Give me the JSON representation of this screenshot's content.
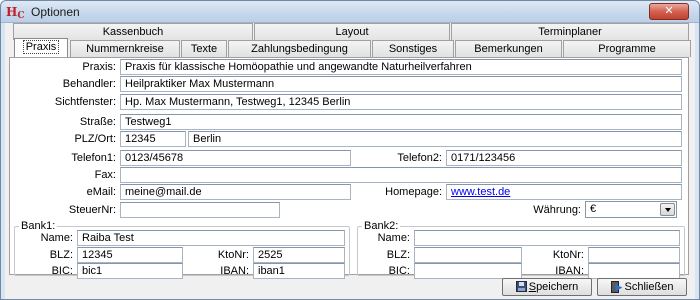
{
  "window": {
    "title": "Optionen",
    "icon_text": "H",
    "icon_sub": "C",
    "close_label": "✕"
  },
  "tabs_top": [
    "Kassenbuch",
    "Layout",
    "Terminplaner"
  ],
  "tabs_sub": [
    "Praxis",
    "Nummernkreise",
    "Texte",
    "Zahlungsbedingung",
    "Sonstiges",
    "Bemerkungen",
    "Programme"
  ],
  "active_tab": "Praxis",
  "form": {
    "praxis_label": "Praxis:",
    "praxis_value": "Praxis für klassische Homöopathie und angewandte Naturheilverfahren",
    "behandler_label": "Behandler:",
    "behandler_value": "Heilpraktiker Max Mustermann",
    "sichtfenster_label": "Sichtfenster:",
    "sichtfenster_value": "Hp. Max Mustermann, Testweg1, 12345 Berlin",
    "strasse_label": "Straße:",
    "strasse_value": "Testweg1",
    "plzort_label": "PLZ/Ort:",
    "plz_value": "12345",
    "ort_value": "Berlin",
    "telefon1_label": "Telefon1:",
    "telefon1_value": "0123/45678",
    "telefon2_label": "Telefon2:",
    "telefon2_value": "0171/123456",
    "fax_label": "Fax:",
    "fax_value": "",
    "email_label": "eMail:",
    "email_value": "meine@mail.de",
    "homepage_label": "Homepage:",
    "homepage_value": "www.test.de",
    "steuernr_label": "SteuerNr:",
    "steuernr_value": "",
    "waehrung_label": "Währung:",
    "waehrung_value": "€"
  },
  "bank1": {
    "title": "Bank1:",
    "name_label": "Name:",
    "name_value": "Raiba Test",
    "blz_label": "BLZ:",
    "blz_value": "12345",
    "ktonr_label": "KtoNr:",
    "ktonr_value": "2525",
    "bic_label": "BIC:",
    "bic_value": "bic1",
    "iban_label": "IBAN:",
    "iban_value": "iban1"
  },
  "bank2": {
    "title": "Bank2:",
    "name_label": "Name:",
    "name_value": "",
    "blz_label": "BLZ:",
    "blz_value": "",
    "ktonr_label": "KtoNr:",
    "ktonr_value": "",
    "bic_label": "BIC:",
    "bic_value": "",
    "iban_label": "IBAN:",
    "iban_value": ""
  },
  "buttons": {
    "save_accel": "S",
    "save_rest": "peichern",
    "close_accel": "",
    "close_label": "Schließen"
  }
}
